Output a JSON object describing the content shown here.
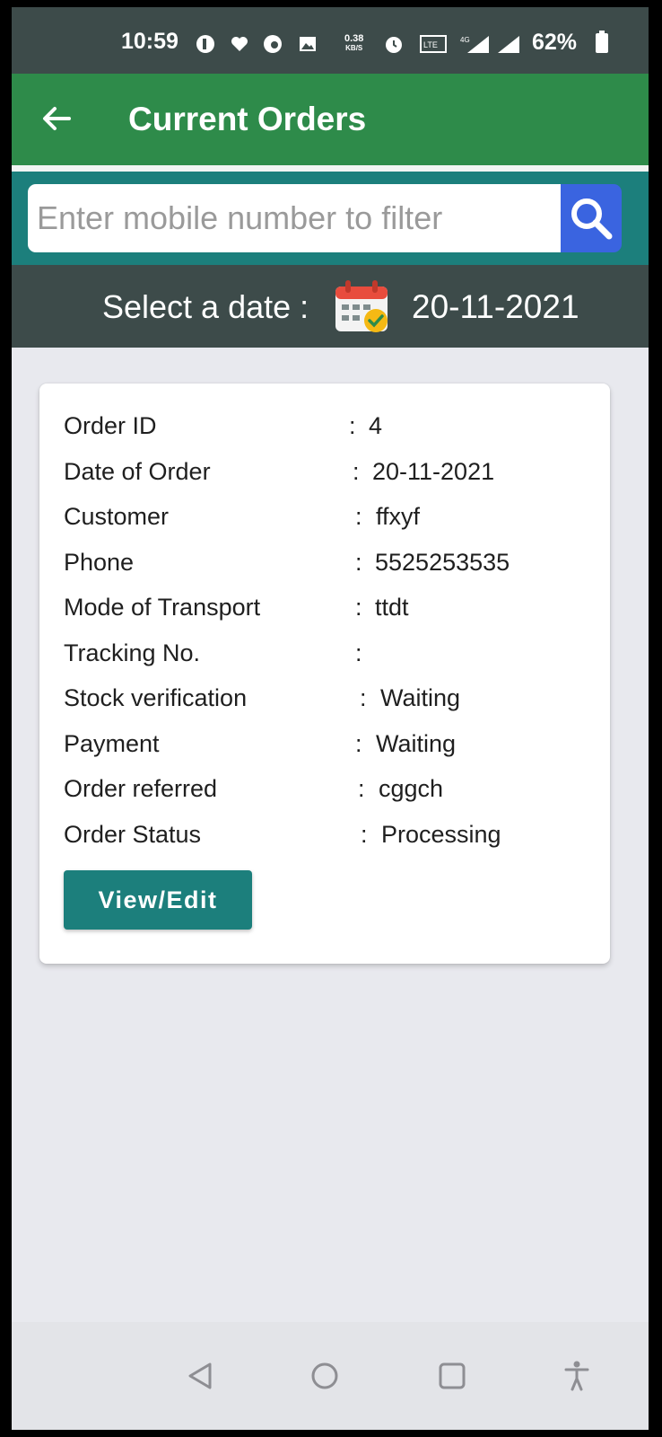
{
  "status_bar": {
    "time": "10:59",
    "speed_top": "0.38",
    "speed_bottom": "KB/S",
    "network": "4G",
    "battery": "62%"
  },
  "app_bar": {
    "title": "Current Orders"
  },
  "search": {
    "placeholder": "Enter mobile number to filter",
    "value": ""
  },
  "date_selector": {
    "label": "Select a date :",
    "value": "20-11-2021"
  },
  "order": {
    "rows": [
      {
        "label": "Order ID",
        "value": "4"
      },
      {
        "label": "Date of Order",
        "value": "20-11-2021"
      },
      {
        "label": "Customer",
        "value": "ffxyf"
      },
      {
        "label": "Phone",
        "value": "5525253535"
      },
      {
        "label": "Mode of Transport",
        "value": "ttdt"
      },
      {
        "label": "Tracking No.",
        "value": ""
      },
      {
        "label": "Stock verification",
        "value": "Waiting"
      },
      {
        "label": "Payment",
        "value": "Waiting"
      },
      {
        "label": "Order referred",
        "value": "cggch"
      },
      {
        "label": "Order Status",
        "value": "Processing"
      }
    ],
    "colon": ":",
    "button_label": "View/Edit"
  },
  "colors": {
    "app_bar": "#2e8b4a",
    "teal": "#1c7f7c",
    "dark": "#3d4b4a",
    "search_button": "#3a64e0"
  }
}
